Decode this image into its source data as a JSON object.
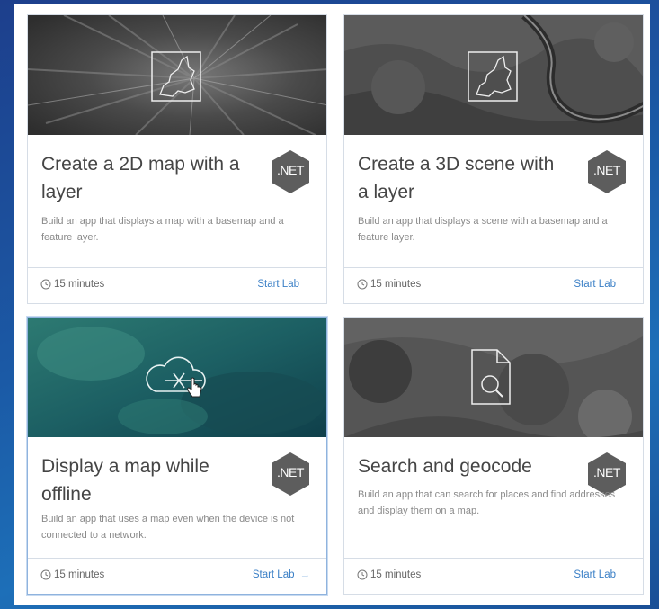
{
  "cards": [
    {
      "title": "Create a 2D map with a layer",
      "badge": ".NET",
      "description": "Build an app that displays a map with a basemap and a feature layer.",
      "duration": "15 minutes",
      "action": "Start Lab"
    },
    {
      "title": "Create a 3D scene with a layer",
      "badge": ".NET",
      "description": "Build an app that displays a scene with a basemap and a feature layer.",
      "duration": "15 minutes",
      "action": "Start Lab"
    },
    {
      "title": "Display a map while offline",
      "badge": ".NET",
      "description": "Build an app that uses a map even when the device is not connected to a network.",
      "duration": "15 minutes",
      "action": "Start Lab",
      "action_arrow": "→"
    },
    {
      "title": "Search and geocode",
      "badge": ".NET",
      "description": "Build an app that can search for places and find addresses and display them on a map.",
      "duration": "15 minutes",
      "action": "Start Lab"
    }
  ],
  "colors": {
    "badge": "#5d5d5d",
    "link": "#3a7fc6",
    "title": "#454545"
  },
  "icons": [
    "map-boundary-icon",
    "map-boundary-icon",
    "offline-cloud-icon",
    "document-search-icon",
    "clock-icon",
    "pointer-cursor-icon"
  ]
}
